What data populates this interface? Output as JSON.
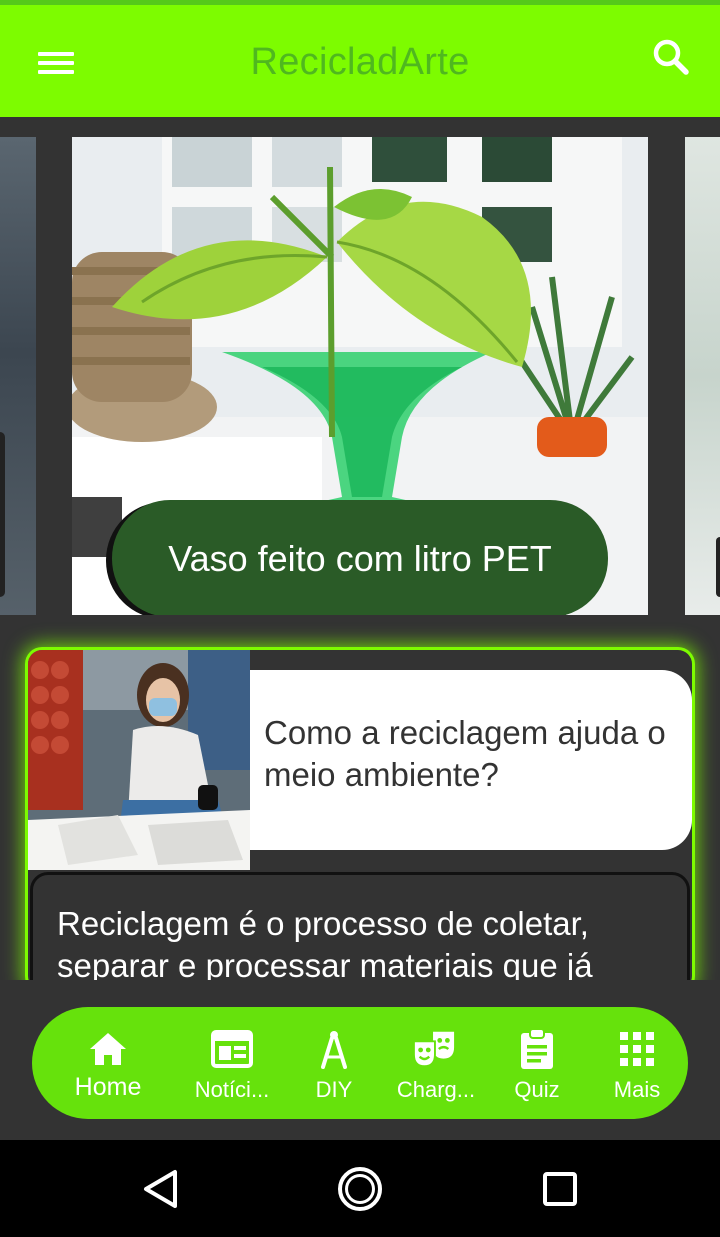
{
  "app": {
    "title": "RecicladArte",
    "brand_color": "#7dfc00",
    "title_color": "#4fb81f"
  },
  "icons": {
    "menu": "hamburger-menu-icon",
    "search": "search-icon"
  },
  "carousel": {
    "current_caption": "Vaso feito com litro PET"
  },
  "article": {
    "title": "Como a reciclagem ajuda o meio ambiente?",
    "excerpt": "Reciclagem é o processo de coletar, separar e processar materiais que já"
  },
  "bottom_nav": {
    "items": [
      {
        "label": "Home",
        "icon": "home-icon",
        "active": true
      },
      {
        "label": "Notíci...",
        "icon": "news-icon",
        "active": false
      },
      {
        "label": "DIY",
        "icon": "compass-drawing-icon",
        "active": false
      },
      {
        "label": "Charg...",
        "icon": "theater-masks-icon",
        "active": false
      },
      {
        "label": "Quiz",
        "icon": "clipboard-icon",
        "active": false
      },
      {
        "label": "Mais",
        "icon": "apps-grid-icon",
        "active": false
      }
    ]
  },
  "system_nav": {
    "back": "back-triangle-icon",
    "home": "home-circle-icon",
    "recents": "recents-square-icon"
  }
}
